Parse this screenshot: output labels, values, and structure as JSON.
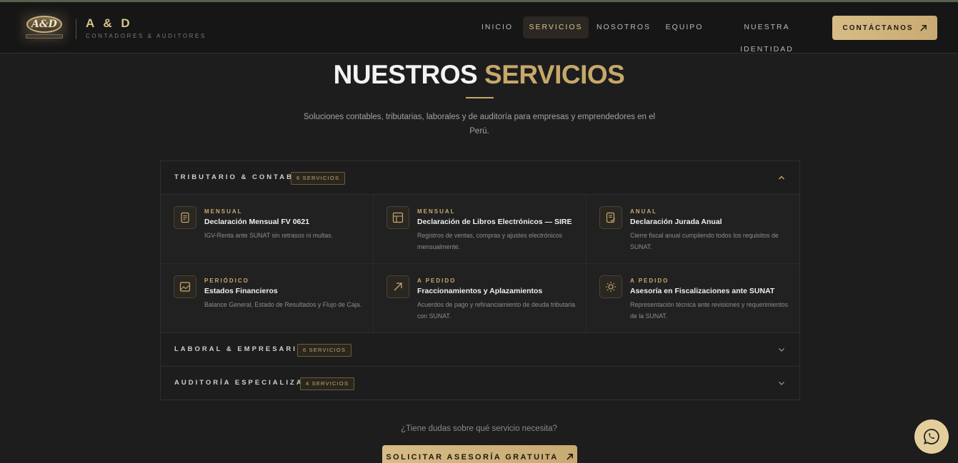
{
  "header": {
    "logo_text": "A&D",
    "brand_name": "A & D",
    "brand_tagline": "CONTADORES & AUDITORES",
    "nav": [
      {
        "label": "INICIO",
        "active": false
      },
      {
        "label": "SERVICIOS",
        "active": true
      },
      {
        "label": "NOSOTROS",
        "active": false
      },
      {
        "label": "EQUIPO",
        "active": false
      },
      {
        "label": "NUESTRA IDENTIDAD",
        "active": false
      }
    ],
    "contact_label": "CONTÁCTANOS",
    "contact_icon": "arrow-up-right-icon"
  },
  "hero": {
    "title_part1": "NUESTROS",
    "title_part2": "SERVICIOS",
    "subtitle": "Soluciones contables, tributarias, laborales y de auditoría para empresas y emprendedores en el Perú."
  },
  "categories": [
    {
      "title": "TRIBUTARIO & CONTABLE",
      "badge": "6 SERVICIOS",
      "expanded": true,
      "services": [
        {
          "frequency": "MENSUAL",
          "name": "Declaración Mensual FV 0621",
          "description": "IGV-Renta ante SUNAT sin retrasos ni multas.",
          "icon": "document-icon"
        },
        {
          "frequency": "MENSUAL",
          "name": "Declaración de Libros Electrónicos — SIRE",
          "description": "Registros de ventas, compras y ajustes electrónicos mensualmente.",
          "icon": "grid-table-icon"
        },
        {
          "frequency": "ANUAL",
          "name": "Declaración Jurada Anual",
          "description": "Cierre fiscal anual cumpliendo todos los requisitos de SUNAT.",
          "icon": "document-check-icon"
        },
        {
          "frequency": "PERIÓDICO",
          "name": "Estados Financieros",
          "description": "Balance General, Estado de Resultados y Flujo de Caja.",
          "icon": "image-chart-icon"
        },
        {
          "frequency": "A PEDIDO",
          "name": "Fraccionamientos y Aplazamientos",
          "description": "Acuerdos de pago y refinanciamiento de deuda tributaria con SUNAT.",
          "icon": "arrow-up-right-icon"
        },
        {
          "frequency": "A PEDIDO",
          "name": "Asesoría en Fiscalizaciones ante SUNAT",
          "description": "Representación técnica ante revisiones y requerimientos de la SUNAT.",
          "icon": "sun-icon"
        }
      ]
    },
    {
      "title": "LABORAL & EMPRESARIAL",
      "badge": "6 SERVICIOS",
      "expanded": false
    },
    {
      "title": "AUDITORÍA ESPECIALIZADA",
      "badge": "4 SERVICIOS",
      "expanded": false
    }
  ],
  "footer_cta": {
    "question": "¿Tiene dudas sobre qué servicio necesita?",
    "button_label": "SOLICITAR ASESORÍA GRATUITA",
    "button_icon": "arrow-up-right-icon"
  },
  "floating": {
    "icon": "whatsapp-icon"
  },
  "colors": {
    "gold": "#c7a76b",
    "background": "#1d1d1d",
    "header": "#161616"
  }
}
